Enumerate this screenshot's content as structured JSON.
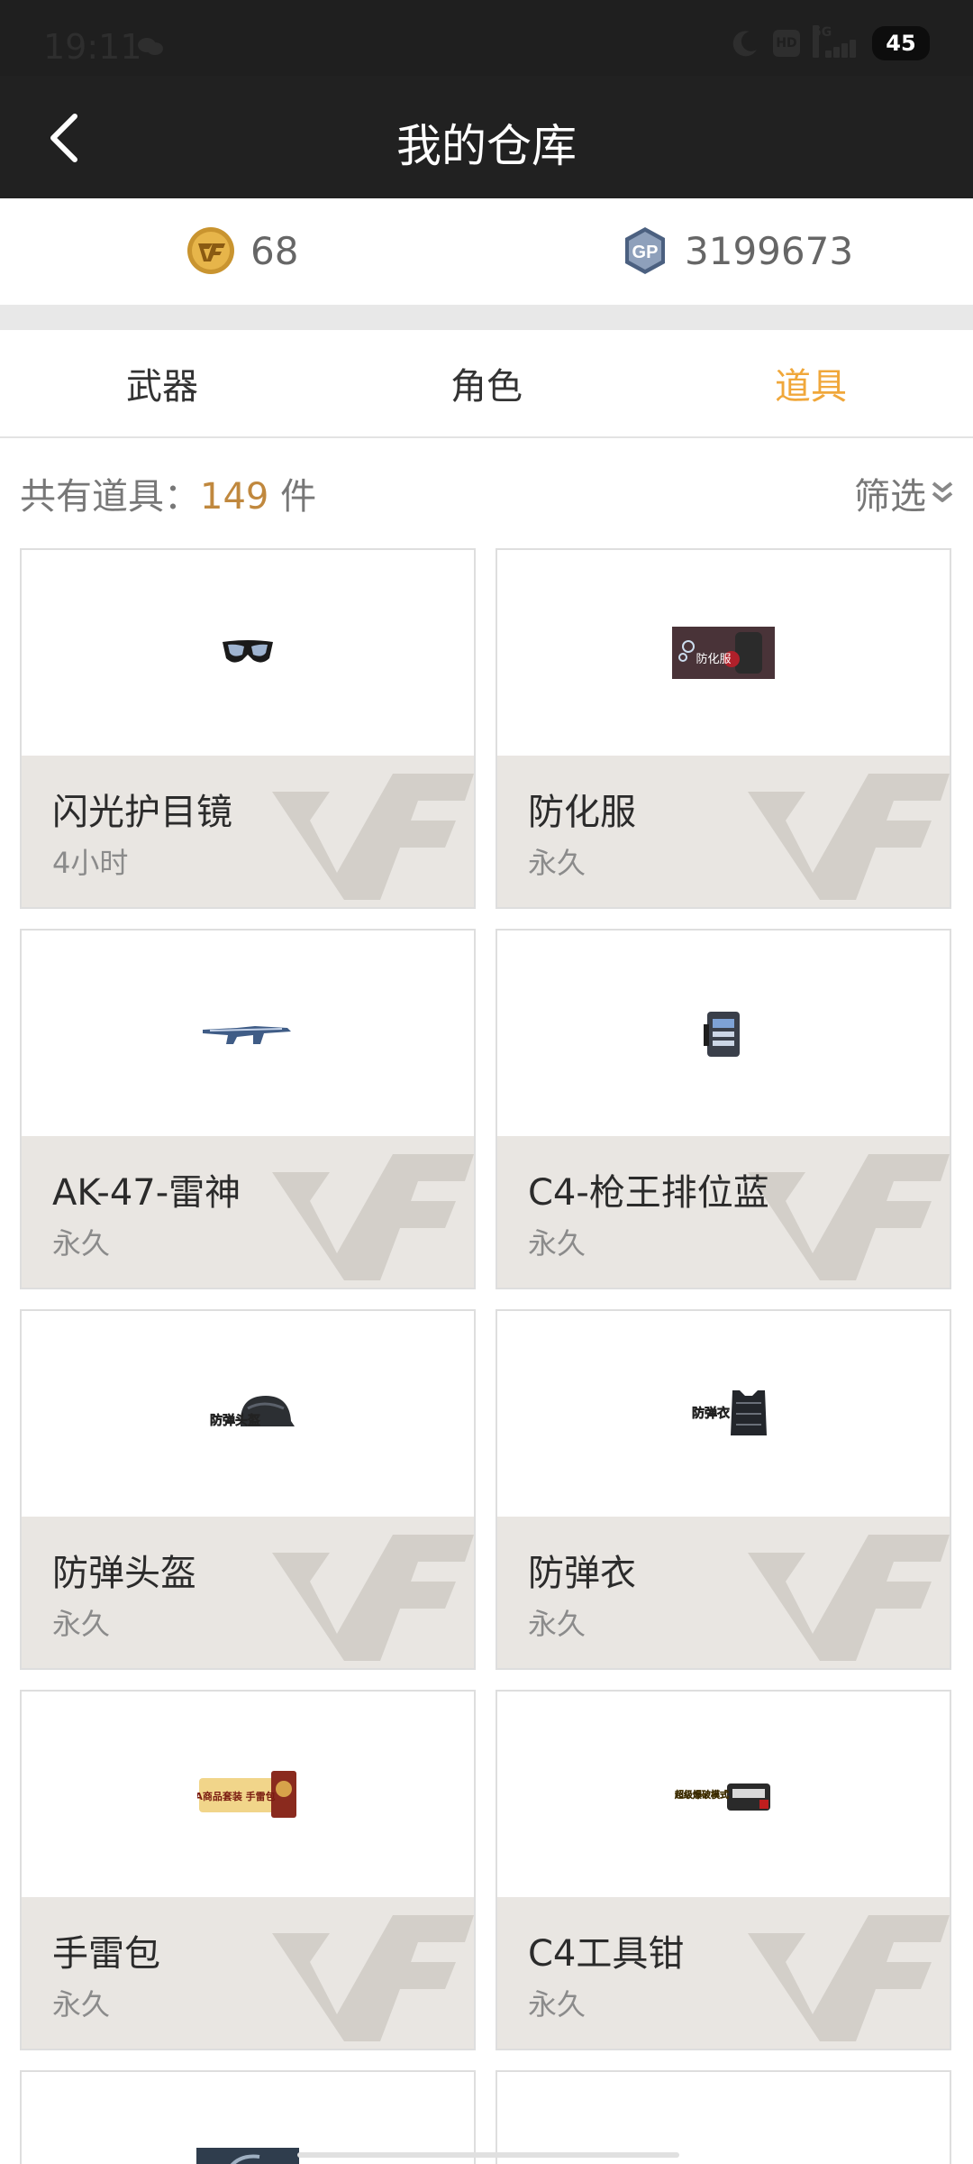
{
  "status_bar": {
    "time": "19:11",
    "hd": "HD",
    "network": "5G",
    "battery": "45"
  },
  "header": {
    "title": "我的仓库"
  },
  "currency": {
    "cf_points": "68",
    "gp_points": "3199673",
    "cf_icon": "cf-coin-icon",
    "gp_icon": "gp-coin-icon",
    "gp_label": "GP"
  },
  "tabs": [
    {
      "label": "武器",
      "active": false
    },
    {
      "label": "角色",
      "active": false
    },
    {
      "label": "道具",
      "active": true
    }
  ],
  "summary": {
    "prefix": "共有道具：",
    "count": "149",
    "suffix": " 件",
    "filter_label": "筛选"
  },
  "items": [
    {
      "name": "闪光护目镜",
      "duration": "4小时",
      "icon": "goggles-icon"
    },
    {
      "name": "防化服",
      "duration": "永久",
      "icon": "hazmat-suit-icon",
      "badge": "防化服"
    },
    {
      "name": "AK-47-雷神",
      "duration": "永久",
      "icon": "rifle-icon"
    },
    {
      "name": "C4-枪王排位蓝",
      "duration": "永久",
      "icon": "c4-bomb-icon"
    },
    {
      "name": "防弹头盔",
      "duration": "永久",
      "icon": "helmet-icon",
      "badge": "防弹头盔"
    },
    {
      "name": "防弹衣",
      "duration": "永久",
      "icon": "vest-icon",
      "badge": "防弹衣"
    },
    {
      "name": "手雷包",
      "duration": "永久",
      "icon": "grenade-pack-icon",
      "badge": "A商品套装 手雷包"
    },
    {
      "name": "C4工具钳",
      "duration": "永久",
      "icon": "c4-pliers-icon",
      "badge": "超级爆破模式"
    }
  ],
  "colors": {
    "accent": "#f0a73a",
    "count": "#c0883e",
    "header_bg": "#212121",
    "card_bottom": "#e9e6e2"
  }
}
